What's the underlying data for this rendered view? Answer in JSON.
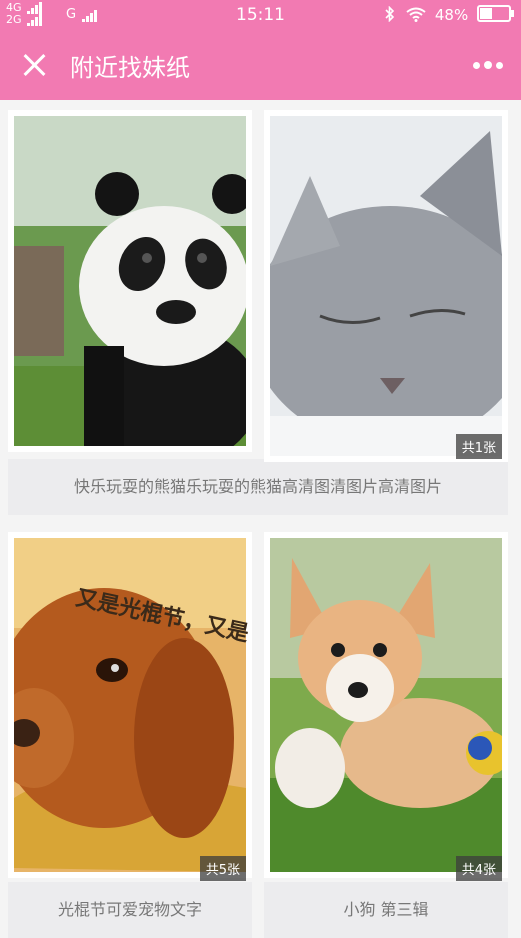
{
  "status_bar": {
    "network_top": "4G",
    "network_bottom": "2G",
    "network_second": "G",
    "time": "15:11",
    "battery": "48%",
    "battery_level": 0.48
  },
  "title_bar": {
    "title": "附近找妹纸",
    "close_icon": "close-icon",
    "more_icon": "more-dots-icon"
  },
  "cards": [
    {
      "name": "panda",
      "badge": "",
      "caption": "快乐玩耍的熊猫"
    },
    {
      "name": "cat",
      "badge": "共1张",
      "caption": "高清图片"
    },
    {
      "name": "dog-golden",
      "badge": "共5张",
      "caption": "光棍节可爱宠物文字",
      "image_text": "又是光棍节，又是"
    },
    {
      "name": "corgi-puppy",
      "badge": "共4张",
      "caption": "小狗 第三辑"
    }
  ],
  "row1_caption": "快乐玩耍的熊猫乐玩耍的熊猫高清图清图片高清图片",
  "colors": {
    "accent": "#f27ab2",
    "background": "#f4f4f4",
    "caption_bg": "#ececee"
  }
}
